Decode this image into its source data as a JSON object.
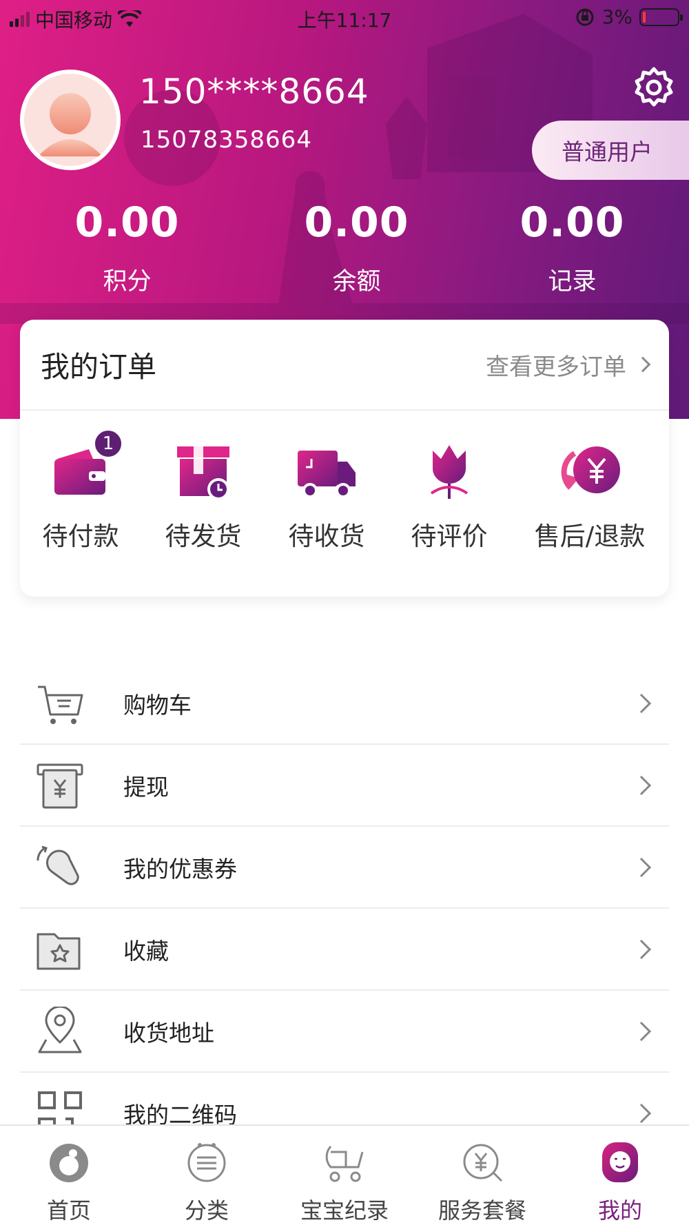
{
  "status_bar": {
    "carrier": "中国移动",
    "time": "上午11:17",
    "battery": "3%"
  },
  "profile": {
    "username": "150****8664",
    "phone": "15078358664",
    "level": "普通用户"
  },
  "stats": [
    {
      "value": "0.00",
      "label": "积分"
    },
    {
      "value": "0.00",
      "label": "余额"
    },
    {
      "value": "0.00",
      "label": "记录"
    }
  ],
  "orders": {
    "title": "我的订单",
    "more": "查看更多订单",
    "items": [
      {
        "label": "待付款",
        "icon": "wallet-icon",
        "badge": "1"
      },
      {
        "label": "待发货",
        "icon": "package-clock-icon"
      },
      {
        "label": "待收货",
        "icon": "truck-icon"
      },
      {
        "label": "待评价",
        "icon": "flower-icon"
      },
      {
        "label": "售后/退款",
        "icon": "refund-yen-icon"
      }
    ]
  },
  "menu": [
    {
      "label": "购物车",
      "icon": "cart-icon"
    },
    {
      "label": "提现",
      "icon": "withdraw-icon"
    },
    {
      "label": "我的优惠券",
      "icon": "coupon-icon"
    },
    {
      "label": "收藏",
      "icon": "favorite-folder-icon"
    },
    {
      "label": "收货地址",
      "icon": "location-icon"
    },
    {
      "label": "我的二维码",
      "icon": "qrcode-icon"
    }
  ],
  "tabs": [
    {
      "label": "首页",
      "icon": "home-baby-icon"
    },
    {
      "label": "分类",
      "icon": "category-icon"
    },
    {
      "label": "宝宝纪录",
      "icon": "stroller-icon"
    },
    {
      "label": "服务套餐",
      "icon": "yen-service-icon"
    },
    {
      "label": "我的",
      "icon": "profile-icon",
      "active": true
    }
  ],
  "colors": {
    "accent": "#7a1f7c",
    "gradient_start": "#df1f86",
    "gradient_end": "#5f1a78",
    "badge": "#5e1f72"
  }
}
